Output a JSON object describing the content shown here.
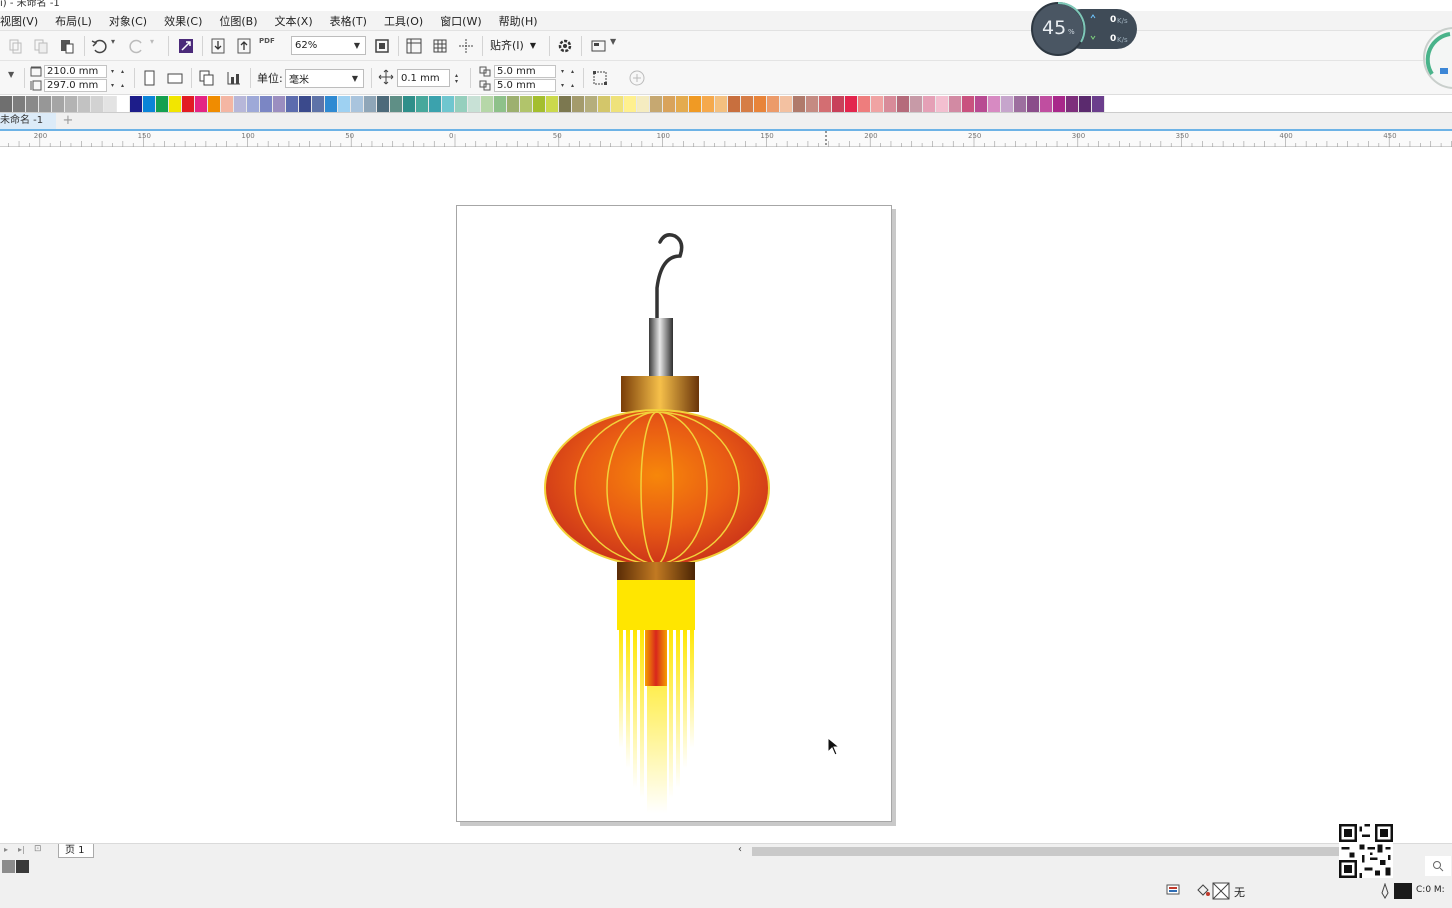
{
  "window": {
    "title": "ı) - 未命名 -1"
  },
  "menu": {
    "items": [
      "视图(V)",
      "布局(L)",
      "对象(C)",
      "效果(C)",
      "位图(B)",
      "文本(X)",
      "表格(T)",
      "工具(O)",
      "窗口(W)",
      "帮助(H)"
    ]
  },
  "toolbar": {
    "zoom_value": "62%",
    "snap_label": "贴齐(I)",
    "pdf_label": "PDF"
  },
  "property_bar": {
    "page_width": "210.0 mm",
    "page_height": "297.0 mm",
    "units_label": "单位:",
    "units_value": "毫米",
    "nudge_value": "0.1 mm",
    "dup_x": "5.0 mm",
    "dup_y": "5.0 mm"
  },
  "palette": {
    "colors": [
      "#6f6f6f",
      "#7d7d7d",
      "#8a8a8a",
      "#979797",
      "#a5a5a5",
      "#b3b3b3",
      "#c2c2c2",
      "#d2d2d2",
      "#e3e3e3",
      "#ffffff",
      "#1d1d8a",
      "#0a84d8",
      "#14a050",
      "#f2e600",
      "#e21b23",
      "#e42484",
      "#f08c00",
      "#f4b6a3",
      "#b7b7d9",
      "#9ea9d8",
      "#7b86c4",
      "#9b8ec0",
      "#5c6cae",
      "#3b4a8c",
      "#5e73a8",
      "#2f8ad2",
      "#9ed1f2",
      "#a9c4dd",
      "#8fa6b8",
      "#4d6a7a",
      "#5f8f86",
      "#2f8f8a",
      "#47a89c",
      "#3ba2ad",
      "#6fc6cf",
      "#95cfbd",
      "#c8e1d6",
      "#b6d7a8",
      "#8ec18a",
      "#9db06f",
      "#b1c46b",
      "#a4be2e",
      "#cbd94c",
      "#7c7850",
      "#a49b6c",
      "#b5ae7c",
      "#d3c66a",
      "#efe27a",
      "#fff08f",
      "#f5ecc0",
      "#c6a871",
      "#d9a35b",
      "#e4ab4e",
      "#f09a24",
      "#f5a94d",
      "#f4c07f",
      "#c86f3e",
      "#d67d46",
      "#e8843a",
      "#ec9b6a",
      "#f3c1a1",
      "#b07a6b",
      "#c58b82",
      "#d36e72",
      "#c8415a",
      "#e3254d",
      "#ee7d7d",
      "#f0a3a3",
      "#d88b99",
      "#b56b7b",
      "#c79aa7",
      "#e5a0b6",
      "#f3bfd0",
      "#d28aa3",
      "#c9527f",
      "#b84b92",
      "#d78ac2",
      "#c6a5cc",
      "#9d6f9f",
      "#8a4d8a",
      "#c04ea0",
      "#a8288a",
      "#7e2f7c",
      "#5b2a6e",
      "#6b3e8c"
    ]
  },
  "document": {
    "tab_label": "未命名 -1",
    "add_tab": "+"
  },
  "ruler": {
    "labels": [
      "200",
      "150",
      "100",
      "50",
      "0",
      "50",
      "100",
      "150",
      "200",
      "250",
      "300",
      "350",
      "400",
      "450"
    ]
  },
  "artwork": {
    "description_colors": {
      "lantern_orange": "#f07a0a",
      "lantern_red": "#d23a12",
      "rib_yellow": "#f6e23b",
      "cap_brown": "#6e3c0c",
      "tassel_yellow": "#ffe600"
    }
  },
  "pages": {
    "page_tab": "页 1"
  },
  "status": {
    "fill_none_label": "无",
    "color_readout": "C:0 M:"
  },
  "speed_widget": {
    "cpu_percent": "45",
    "percent_sign": "%",
    "upload": "0",
    "download": "0",
    "unit": "K/s"
  }
}
